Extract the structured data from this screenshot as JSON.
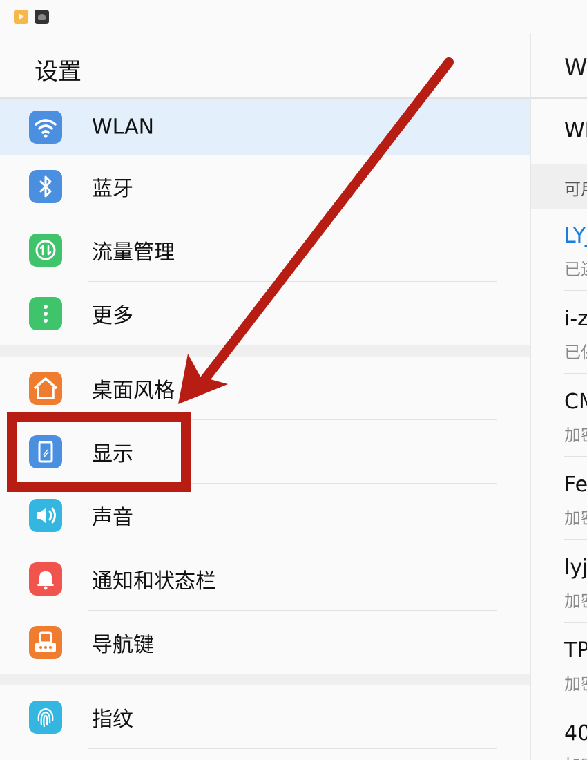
{
  "left_panel": {
    "title": "设置",
    "items": [
      {
        "label": "WLAN",
        "icon": "wifi-icon",
        "color": "#4a8fe0",
        "selected": true
      },
      {
        "label": "蓝牙",
        "icon": "bluetooth-icon",
        "color": "#4a8fe0"
      },
      {
        "label": "流量管理",
        "icon": "traffic-icon",
        "color": "#3fc46c"
      },
      {
        "label": "更多",
        "icon": "more-icon",
        "color": "#3fc46c"
      },
      {
        "label": "桌面风格",
        "icon": "home-style-icon",
        "color": "#f07c30"
      },
      {
        "label": "显示",
        "icon": "display-icon",
        "color": "#4a8fe0"
      },
      {
        "label": "声音",
        "icon": "sound-icon",
        "color": "#35b6e0"
      },
      {
        "label": "通知和状态栏",
        "icon": "notification-icon",
        "color": "#f0544c"
      },
      {
        "label": "导航键",
        "icon": "navigation-key-icon",
        "color": "#f07c30"
      },
      {
        "label": "指纹",
        "icon": "fingerprint-icon",
        "color": "#35b6e0"
      }
    ]
  },
  "right_panel": {
    "title": "W",
    "wlan_label": "WL",
    "section_header": "可用",
    "networks": [
      {
        "name": "LYJ",
        "status": "已连",
        "name_color": "#1a7de0"
      },
      {
        "name": "i-z",
        "status": "已保"
      },
      {
        "name": "CM",
        "status": "加密"
      },
      {
        "name": "Fe",
        "status": "加密"
      },
      {
        "name": "lyj-",
        "status": "加密"
      },
      {
        "name": "TP",
        "status": "加密"
      },
      {
        "name": "40",
        "status": "加密"
      }
    ]
  },
  "annotation": {
    "color": "#b81d14",
    "target": "显示"
  }
}
